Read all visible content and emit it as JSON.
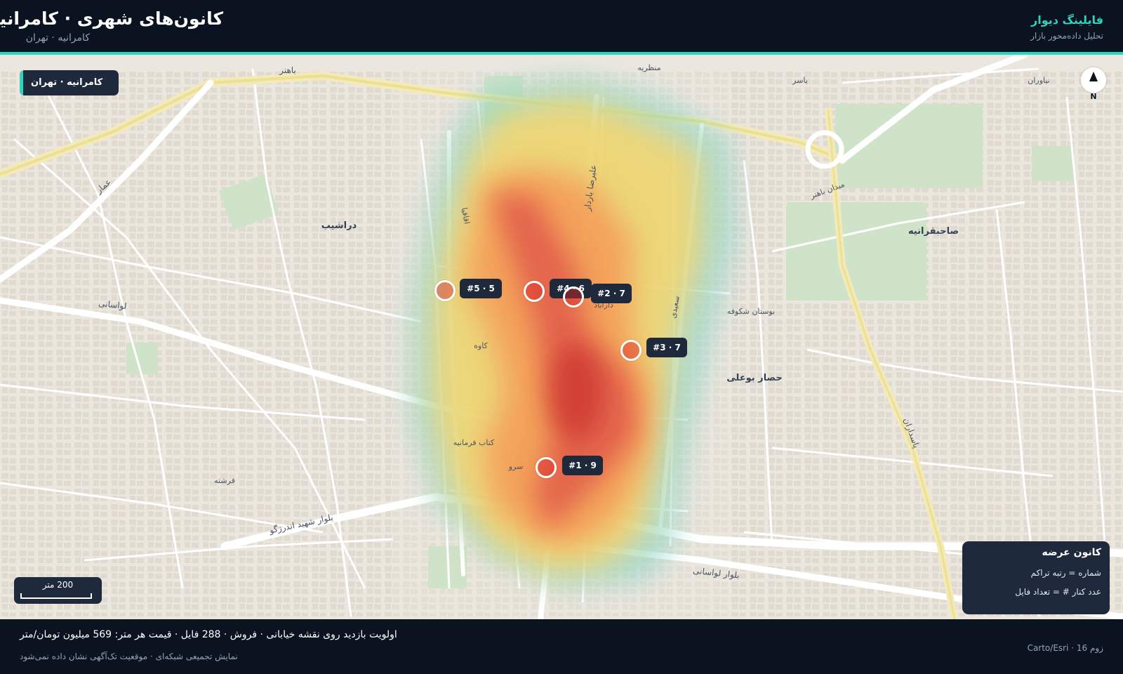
{
  "header": {
    "title": "کانون‌های شهری · کامرانیه",
    "subtitle": "کامرانیه · تهران",
    "brand": "فایلینگ دیوار",
    "brand_tagline": "تحلیل داده‌محور بازار"
  },
  "map": {
    "location_chip": "کامرانیه · تهران",
    "compass_label": "N",
    "scale_label": "200 متر",
    "colors": {
      "accent": "#2dd4bf",
      "panel": "#1e293b",
      "marker": "#dc2626"
    },
    "place_labels": [
      "دراشیب",
      "صاحبقرانیه",
      "حصار بوعلی",
      "بوستان شکوفه",
      "میدان باهنر",
      "باهنر",
      "لواسانی",
      "بلوار شهید اندرزگو",
      "بلوار لواسانی",
      "پاسداران",
      "علیرضا باردار",
      "عمار",
      "اقاقیا",
      "فرشته",
      "دارآباد",
      "نیاوران",
      "سعیدی",
      "منظریه",
      "یاسر",
      "کاوه",
      "سرو",
      "کتاب فرمانیه"
    ],
    "hotspots": [
      {
        "rank": 1,
        "count": 9,
        "label": "#1 · 9"
      },
      {
        "rank": 2,
        "count": 7,
        "label": "#2 · 7"
      },
      {
        "rank": 3,
        "count": 7,
        "label": "#3 · 7"
      },
      {
        "rank": 4,
        "count": 6,
        "label": "#4 · 6"
      },
      {
        "rank": 5,
        "count": 5,
        "label": "#5 · 5"
      }
    ]
  },
  "legend": {
    "title": "کانون عرضه",
    "line1": "شماره = رتبه تراکم",
    "line2": "عدد کنار # = تعداد فایل"
  },
  "footer": {
    "stats": "اولویت بازدید روی نقشه خیابانی · فروش · 288 فایل · قیمت هر متر: 569 میلیون تومان/متر",
    "note": "نمایش تجمیعی شبکه‌ای · موقعیت تک‌آگهی نشان داده نمی‌شود",
    "attribution": "Carto/Esri · زوم 16"
  }
}
